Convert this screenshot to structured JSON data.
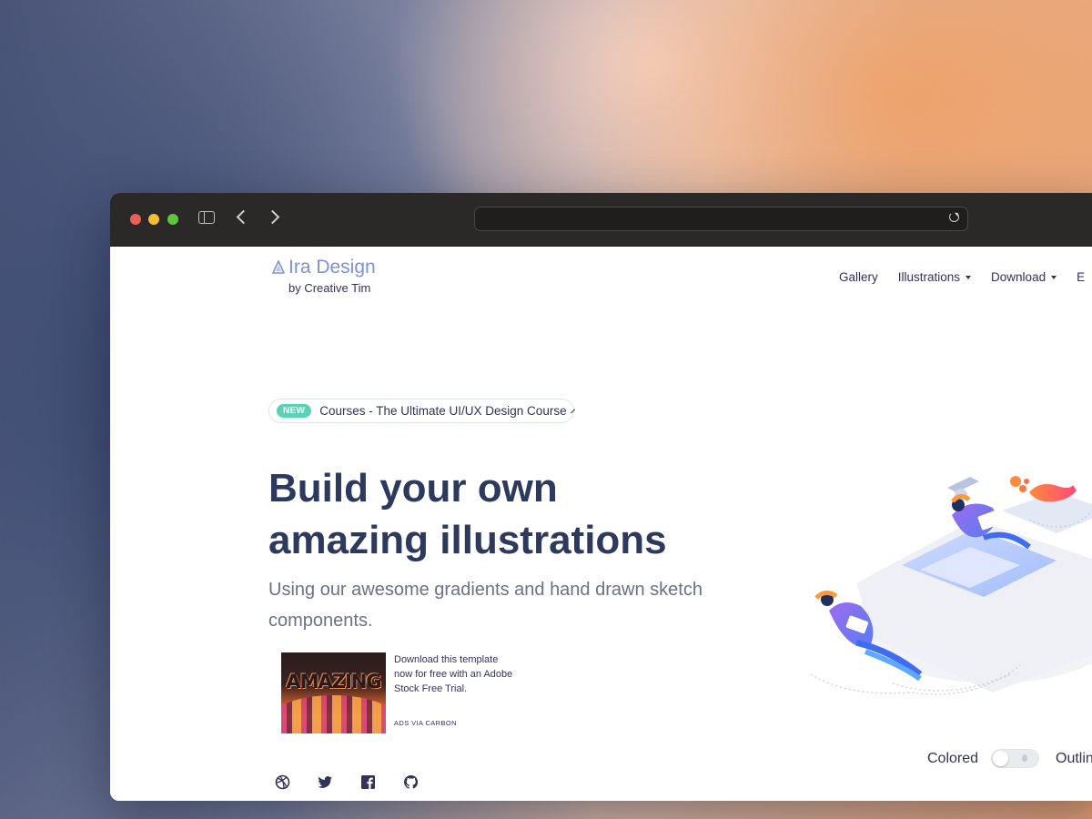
{
  "site": {
    "logo_title": "Ira Design",
    "logo_subtitle": "by Creative Tim"
  },
  "nav": {
    "items": [
      {
        "label": "Gallery",
        "has_caret": false
      },
      {
        "label": "Illustrations",
        "has_caret": true
      },
      {
        "label": "Download",
        "has_caret": true
      },
      {
        "label": "E",
        "has_caret": false
      }
    ]
  },
  "announcement": {
    "badge": "NEW",
    "text": "Courses - The Ultimate UI/UX Design Course"
  },
  "hero": {
    "headline_line1": "Build your own",
    "headline_line2": "amazing illustrations",
    "subheadline": "Using our awesome gradients and hand drawn sketch components."
  },
  "ad": {
    "image_word": "AMAZING",
    "text": "Download this template now for free with an Adobe Stock Free Trial.",
    "via": "ADS VIA CARBON"
  },
  "social": [
    "dribbble-icon",
    "twitter-icon",
    "facebook-icon",
    "github-icon"
  ],
  "style_toggle": {
    "left_label": "Colored",
    "right_label": "Outlin",
    "state": "off"
  },
  "colors": {
    "accent": "#7d93d6",
    "text_dark": "#32325d",
    "headline": "#2d3a5e",
    "badge_green": "#59d3b4"
  }
}
